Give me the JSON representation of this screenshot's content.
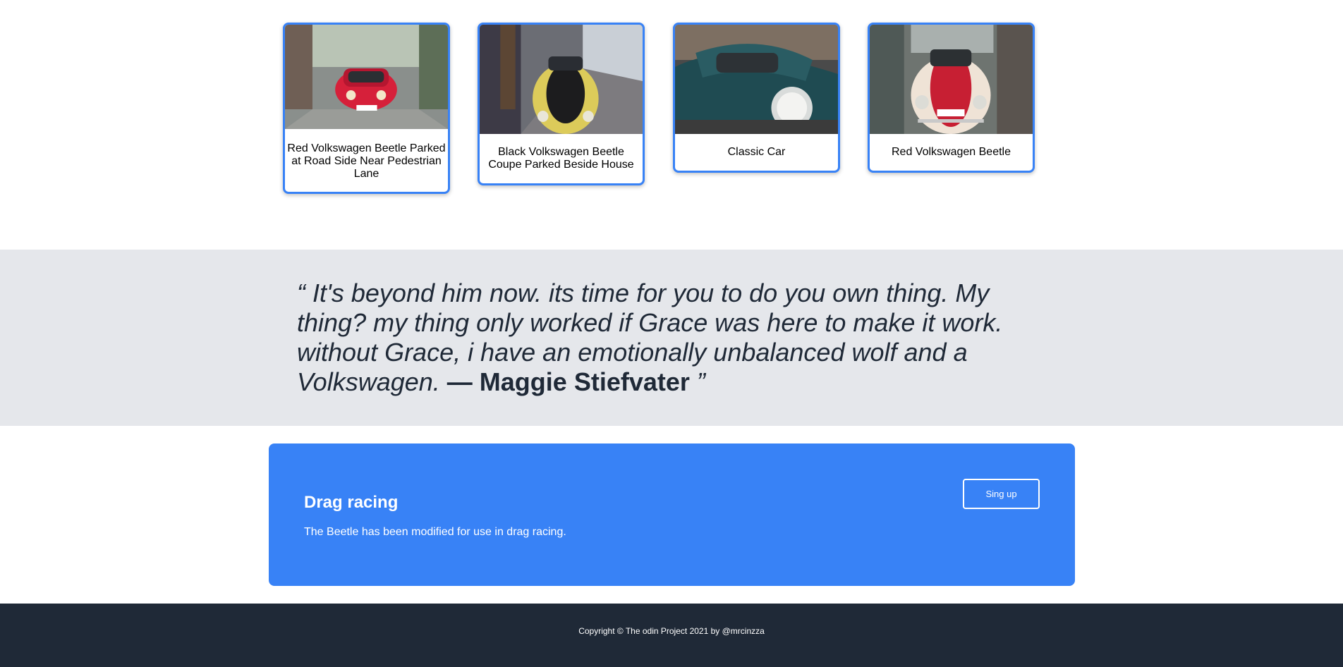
{
  "cards": [
    {
      "caption": "Red Volkswagen Beetle Parked at Road Side Near Pedestrian Lane"
    },
    {
      "caption": "Black Volkswagen Beetle Coupe Parked Beside House"
    },
    {
      "caption": "Classic Car"
    },
    {
      "caption": "Red Volkswagen Beetle"
    }
  ],
  "quote": {
    "open_mark": "“",
    "text": " It's beyond him now. its time for you to do you own thing. My thing? my thing only worked if Grace was here to make it work. without Grace, i have an emotionally unbalanced wolf and a Volkswagen. ",
    "author": "— Maggie Stiefvater",
    "close_mark": " ”"
  },
  "cta": {
    "title": "Drag racing",
    "text": "The Beetle has been modified for use in drag racing.",
    "button_label": "Sing up"
  },
  "footer": {
    "copyright": "Copyright © The odin Project 2021 by @mrcinzza"
  },
  "colors": {
    "accent": "#3882f6",
    "quote_band": "#e5e7eb",
    "footer_bg": "#1f2937",
    "text_dark": "#1f2937"
  }
}
